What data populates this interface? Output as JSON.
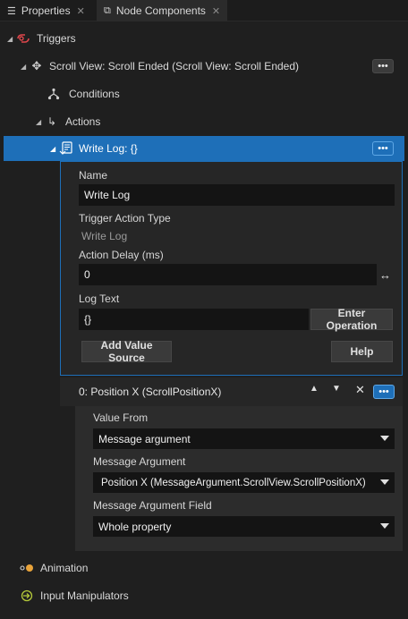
{
  "tabs": [
    {
      "label": "Properties",
      "icon": "list-icon",
      "active": false
    },
    {
      "label": "Node Components",
      "icon": "node-components-icon",
      "active": true
    }
  ],
  "tree": {
    "triggers_label": "Triggers",
    "trigger_label": "Scroll View: Scroll Ended (Scroll View: Scroll Ended)",
    "conditions_label": "Conditions",
    "actions_label": "Actions",
    "action_label": "Write Log: {}",
    "more_glyph": "•••"
  },
  "action_details": {
    "name_label": "Name",
    "name_value": "Write Log",
    "type_label": "Trigger Action Type",
    "type_value": "Write Log",
    "delay_label": "Action Delay (ms)",
    "delay_value": "0",
    "log_text_label": "Log Text",
    "log_text_value": "{}",
    "enter_operation_label": "Enter Operation",
    "add_value_source_label": "Add Value Source",
    "help_label": "Help"
  },
  "value_source": {
    "header_label": "0: Position X (ScrollPositionX)",
    "value_from_label": "Value From",
    "value_from_selected": "Message argument",
    "message_argument_label": "Message Argument",
    "message_argument_selected": "Position X (MessageArgument.ScrollView.ScrollPositionX)",
    "message_argument_field_label": "Message Argument Field",
    "message_argument_field_selected": "Whole property"
  },
  "bottom_sections": {
    "animation_label": "Animation",
    "input_manipulators_label": "Input Manipulators"
  },
  "colors": {
    "accent": "#1e6fb8",
    "triggers_icon": "#e0474c",
    "animation_icon": "#e8a33a",
    "input_icon": "#b5c93a"
  }
}
